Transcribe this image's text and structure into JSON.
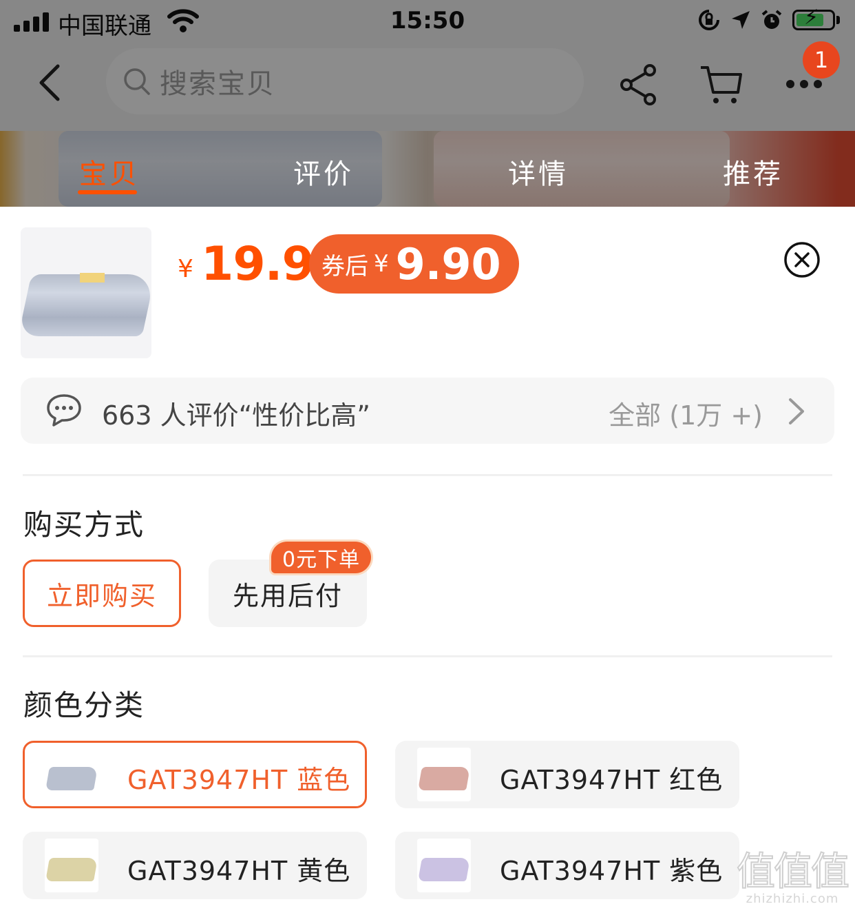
{
  "status_bar": {
    "carrier": "中国联通",
    "time": "15:50"
  },
  "nav": {
    "search_placeholder": "搜索宝贝",
    "cart_badge": "1"
  },
  "tabs": [
    {
      "label": "宝贝",
      "active": true
    },
    {
      "label": "评价",
      "active": false
    },
    {
      "label": "详情",
      "active": false
    },
    {
      "label": "推荐",
      "active": false
    }
  ],
  "product": {
    "currency": "¥",
    "price": "19.9",
    "coupon_label": "券后",
    "coupon_currency": "¥",
    "coupon_price": "9.90"
  },
  "review": {
    "text": "663 人评价“性价比高”",
    "all_label": "全部 (1万 +)"
  },
  "purchase": {
    "title": "购买方式",
    "options": [
      "立即购买",
      "先用后付"
    ],
    "tag": "0元下单"
  },
  "colors": {
    "title": "颜色分类",
    "options": [
      {
        "label": "GAT3947HT 蓝色",
        "swatch": "#b9c0cf",
        "selected": true
      },
      {
        "label": "GAT3947HT 红色",
        "swatch": "#d9aaa2",
        "selected": false
      },
      {
        "label": "GAT3947HT 黄色",
        "swatch": "#dcd3a6",
        "selected": false
      },
      {
        "label": "GAT3947HT 紫色",
        "swatch": "#cbc2e3",
        "selected": false
      }
    ]
  },
  "watermark": {
    "big": "值值值",
    "small": "zhizhizhi.com"
  },
  "theme": {
    "accent": "#f0602c",
    "price_color": "#ff5000"
  }
}
